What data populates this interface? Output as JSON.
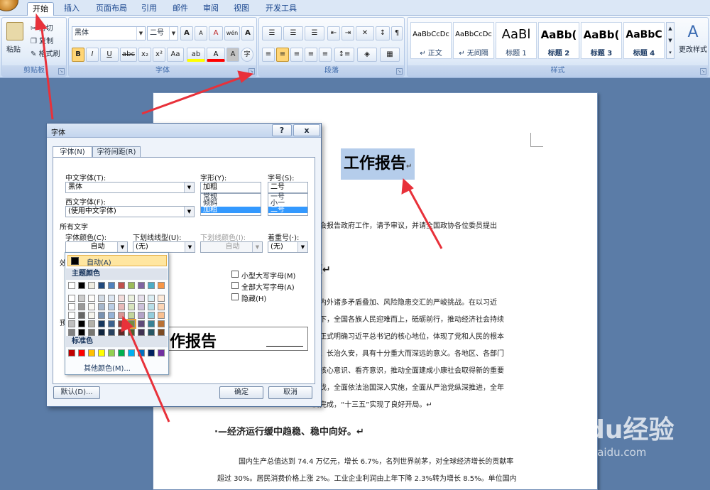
{
  "tabs": [
    {
      "label": "开始",
      "active": true
    },
    {
      "label": "插入"
    },
    {
      "label": "页面布局"
    },
    {
      "label": "引用"
    },
    {
      "label": "邮件"
    },
    {
      "label": "审阅"
    },
    {
      "label": "视图"
    },
    {
      "label": "开发工具"
    }
  ],
  "ribbon": {
    "clipboard": {
      "paste": "粘贴",
      "cut": "剪切",
      "copy": "复制",
      "format_painter": "格式刷",
      "label": "剪贴板"
    },
    "font": {
      "name": "黑体",
      "size": "二号",
      "label": "字体",
      "bold": "B",
      "italic": "I",
      "underline": "U",
      "strike": "abc",
      "sub": "x₂",
      "sup": "x²",
      "case": "Aa",
      "highlight": "ab",
      "color": "A",
      "grow": "A",
      "shrink": "A",
      "clear": "A",
      "wen": "wén",
      "frame": "A",
      "circle": "字"
    },
    "paragraph": {
      "label": "段落"
    },
    "styles": {
      "label": "样式",
      "items": [
        {
          "preview": "AaBbCcDc",
          "name": "↵ 正文"
        },
        {
          "preview": "AaBbCcDc",
          "name": "↵ 无间隔"
        },
        {
          "preview": "AaBl",
          "name": "标题 1"
        },
        {
          "preview": "AaBb(",
          "name": "标题 2"
        },
        {
          "preview": "AaBb(",
          "name": "标题 3"
        },
        {
          "preview": "AaBbC",
          "name": "标题 4"
        }
      ],
      "change": "更改样式"
    }
  },
  "document": {
    "title": "工作报告",
    "title_mark": "↵",
    "lines": [
      "大会报告政府工作，请予审议，并请全国政协各位委员提出",
      "顾↵",
      "国内外诸多矛盾叠加、风险隐患交汇的严峻挑战。在以习近",
      "导下，全国各族人民迎难而上，砥砺前行，推动经济社会持续",
      "会正式明确习近平总书记的核心地位，体现了党和人民的根本",
      "达、长治久安，具有十分重大而深远的意义。各地区、各部门",
      "、核心意识、看齐意识，推动全面建成小康社会取得新的重要",
      "步伐，全面依法治国深入实施，全面从严治党纵深推进，全年",
      "满完成，“十三五”实现了良好开局。↵"
    ],
    "heading2": "·—经济运行缓中趋稳、稳中向好。↵",
    "para": "国内生产总值达到 74.4 万亿元，增长 6.7%，名列世界前茅，对全球经济增长的贡献率",
    "para2": "超过 30%。居民消费价格上涨 2%。工业企业利润由上年下降 2.3%转为增长 8.5%。单位国内"
  },
  "dialog": {
    "title": "字体",
    "help": "?",
    "close": "x",
    "tab_font": "字体(N)",
    "tab_spacing": "字符间距(R)",
    "cn_font_label": "中文字体(T):",
    "cn_font_value": "黑体",
    "style_label": "字形(Y):",
    "style_value": "加粗",
    "style_options": [
      "常规",
      "倾斜",
      "加粗"
    ],
    "size_label": "字号(S):",
    "size_value": "二号",
    "size_options": [
      "一号",
      "小一",
      "二号"
    ],
    "west_font_label": "西文字体(F):",
    "west_font_value": "(使用中文字体)",
    "all_text": "所有文字",
    "color_label": "字体颜色(C):",
    "color_value": "自动",
    "underline_label": "下划线线型(U):",
    "underline_value": "(无)",
    "uline_color_label": "下划线颜色(I):",
    "uline_color_value": "自动",
    "emphasis_label": "着重号(·):",
    "emphasis_value": "(无)",
    "effects_label": "效",
    "effects": [
      "小型大写字母(M)",
      "全部大写字母(A)",
      "隐藏(H)"
    ],
    "preview_label": "预",
    "preview_text": "作报告",
    "default_btn": "默认(D)...",
    "ok_btn": "确定",
    "cancel_btn": "取消"
  },
  "color_menu": {
    "auto": "自动(A)",
    "theme": "主题颜色",
    "standard": "标准色",
    "more": "其他颜色(M)...",
    "theme_top": [
      "#ffffff",
      "#000000",
      "#eeece1",
      "#1f497d",
      "#4f81bd",
      "#c0504d",
      "#9bbb59",
      "#8064a2",
      "#4bacc6",
      "#f79646"
    ],
    "standard_colors": [
      "#c00000",
      "#ff0000",
      "#ffc000",
      "#ffff00",
      "#92d050",
      "#00b050",
      "#00b0f0",
      "#0070c0",
      "#002060",
      "#7030a0"
    ]
  },
  "watermark": {
    "brand": "Baidu经验",
    "url": "jingyan.baidu.com"
  }
}
